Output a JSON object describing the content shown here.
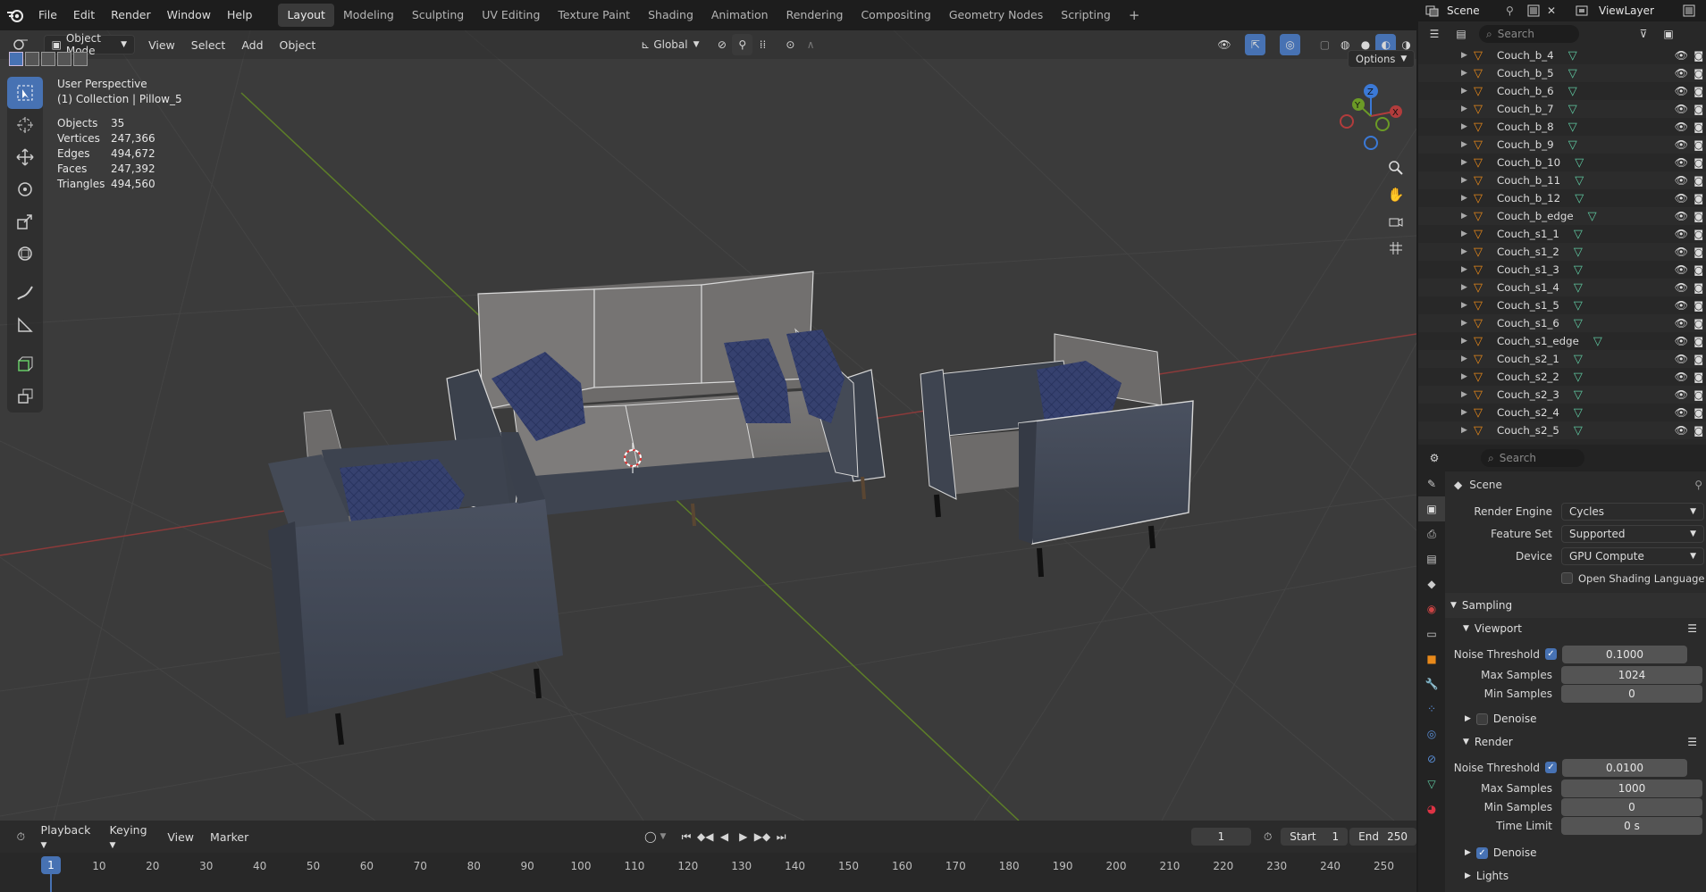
{
  "menu": {
    "file": "File",
    "edit": "Edit",
    "render": "Render",
    "window": "Window",
    "help": "Help"
  },
  "workspaces": [
    "Layout",
    "Modeling",
    "Sculpting",
    "UV Editing",
    "Texture Paint",
    "Shading",
    "Animation",
    "Rendering",
    "Compositing",
    "Geometry Nodes",
    "Scripting"
  ],
  "topright": {
    "scene": "Scene",
    "viewlayer": "ViewLayer"
  },
  "viewport_header": {
    "mode": "Object Mode",
    "view": "View",
    "select": "Select",
    "add": "Add",
    "object": "Object",
    "orientation": "Global",
    "options": "Options"
  },
  "overlay": {
    "perspective": "User Perspective",
    "collection": "(1) Collection | Pillow_5",
    "stats": [
      {
        "k": "Objects",
        "v": "35"
      },
      {
        "k": "Vertices",
        "v": "247,366"
      },
      {
        "k": "Edges",
        "v": "494,672"
      },
      {
        "k": "Faces",
        "v": "247,392"
      },
      {
        "k": "Triangles",
        "v": "494,560"
      }
    ]
  },
  "gizmo": {
    "z": "Z",
    "y": "Y",
    "x": "X"
  },
  "timeline": {
    "playback": "Playback",
    "keying": "Keying",
    "view": "View",
    "marker": "Marker",
    "current_frame": "1",
    "start_label": "Start",
    "start": "1",
    "end_label": "End",
    "end": "250",
    "ticks": [
      "1",
      "10",
      "20",
      "30",
      "40",
      "50",
      "60",
      "70",
      "80",
      "90",
      "100",
      "110",
      "120",
      "130",
      "140",
      "150",
      "160",
      "170",
      "180",
      "190",
      "200",
      "210",
      "220",
      "230",
      "240",
      "250"
    ]
  },
  "outliner": {
    "search_placeholder": "Search",
    "items": [
      "Couch_b_4",
      "Couch_b_5",
      "Couch_b_6",
      "Couch_b_7",
      "Couch_b_8",
      "Couch_b_9",
      "Couch_b_10",
      "Couch_b_11",
      "Couch_b_12",
      "Couch_b_edge",
      "Couch_s1_1",
      "Couch_s1_2",
      "Couch_s1_3",
      "Couch_s1_4",
      "Couch_s1_5",
      "Couch_s1_6",
      "Couch_s1_edge",
      "Couch_s2_1",
      "Couch_s2_2",
      "Couch_s2_3",
      "Couch_s2_4",
      "Couch_s2_5"
    ]
  },
  "properties": {
    "search_placeholder": "Search",
    "context": "Scene",
    "render_engine_label": "Render Engine",
    "render_engine": "Cycles",
    "feature_set_label": "Feature Set",
    "feature_set": "Supported",
    "device_label": "Device",
    "device": "GPU Compute",
    "osl_label": "Open Shading Language",
    "sampling": "Sampling",
    "viewport": "Viewport",
    "vp_noise_label": "Noise Threshold",
    "vp_noise": "0.1000",
    "vp_max_label": "Max Samples",
    "vp_max": "1024",
    "vp_min_label": "Min Samples",
    "vp_min": "0",
    "denoise": "Denoise",
    "render": "Render",
    "r_noise_label": "Noise Threshold",
    "r_noise": "0.0100",
    "r_max_label": "Max Samples",
    "r_max": "1000",
    "r_min_label": "Min Samples",
    "r_min": "0",
    "time_limit_label": "Time Limit",
    "time_limit": "0 s",
    "denoise2": "Denoise",
    "lights": "Lights"
  },
  "colors": {
    "accent": "#4772b3",
    "x_axis": "#b23c3c",
    "y_axis": "#6b9a26",
    "z_axis": "#3b79d6"
  }
}
